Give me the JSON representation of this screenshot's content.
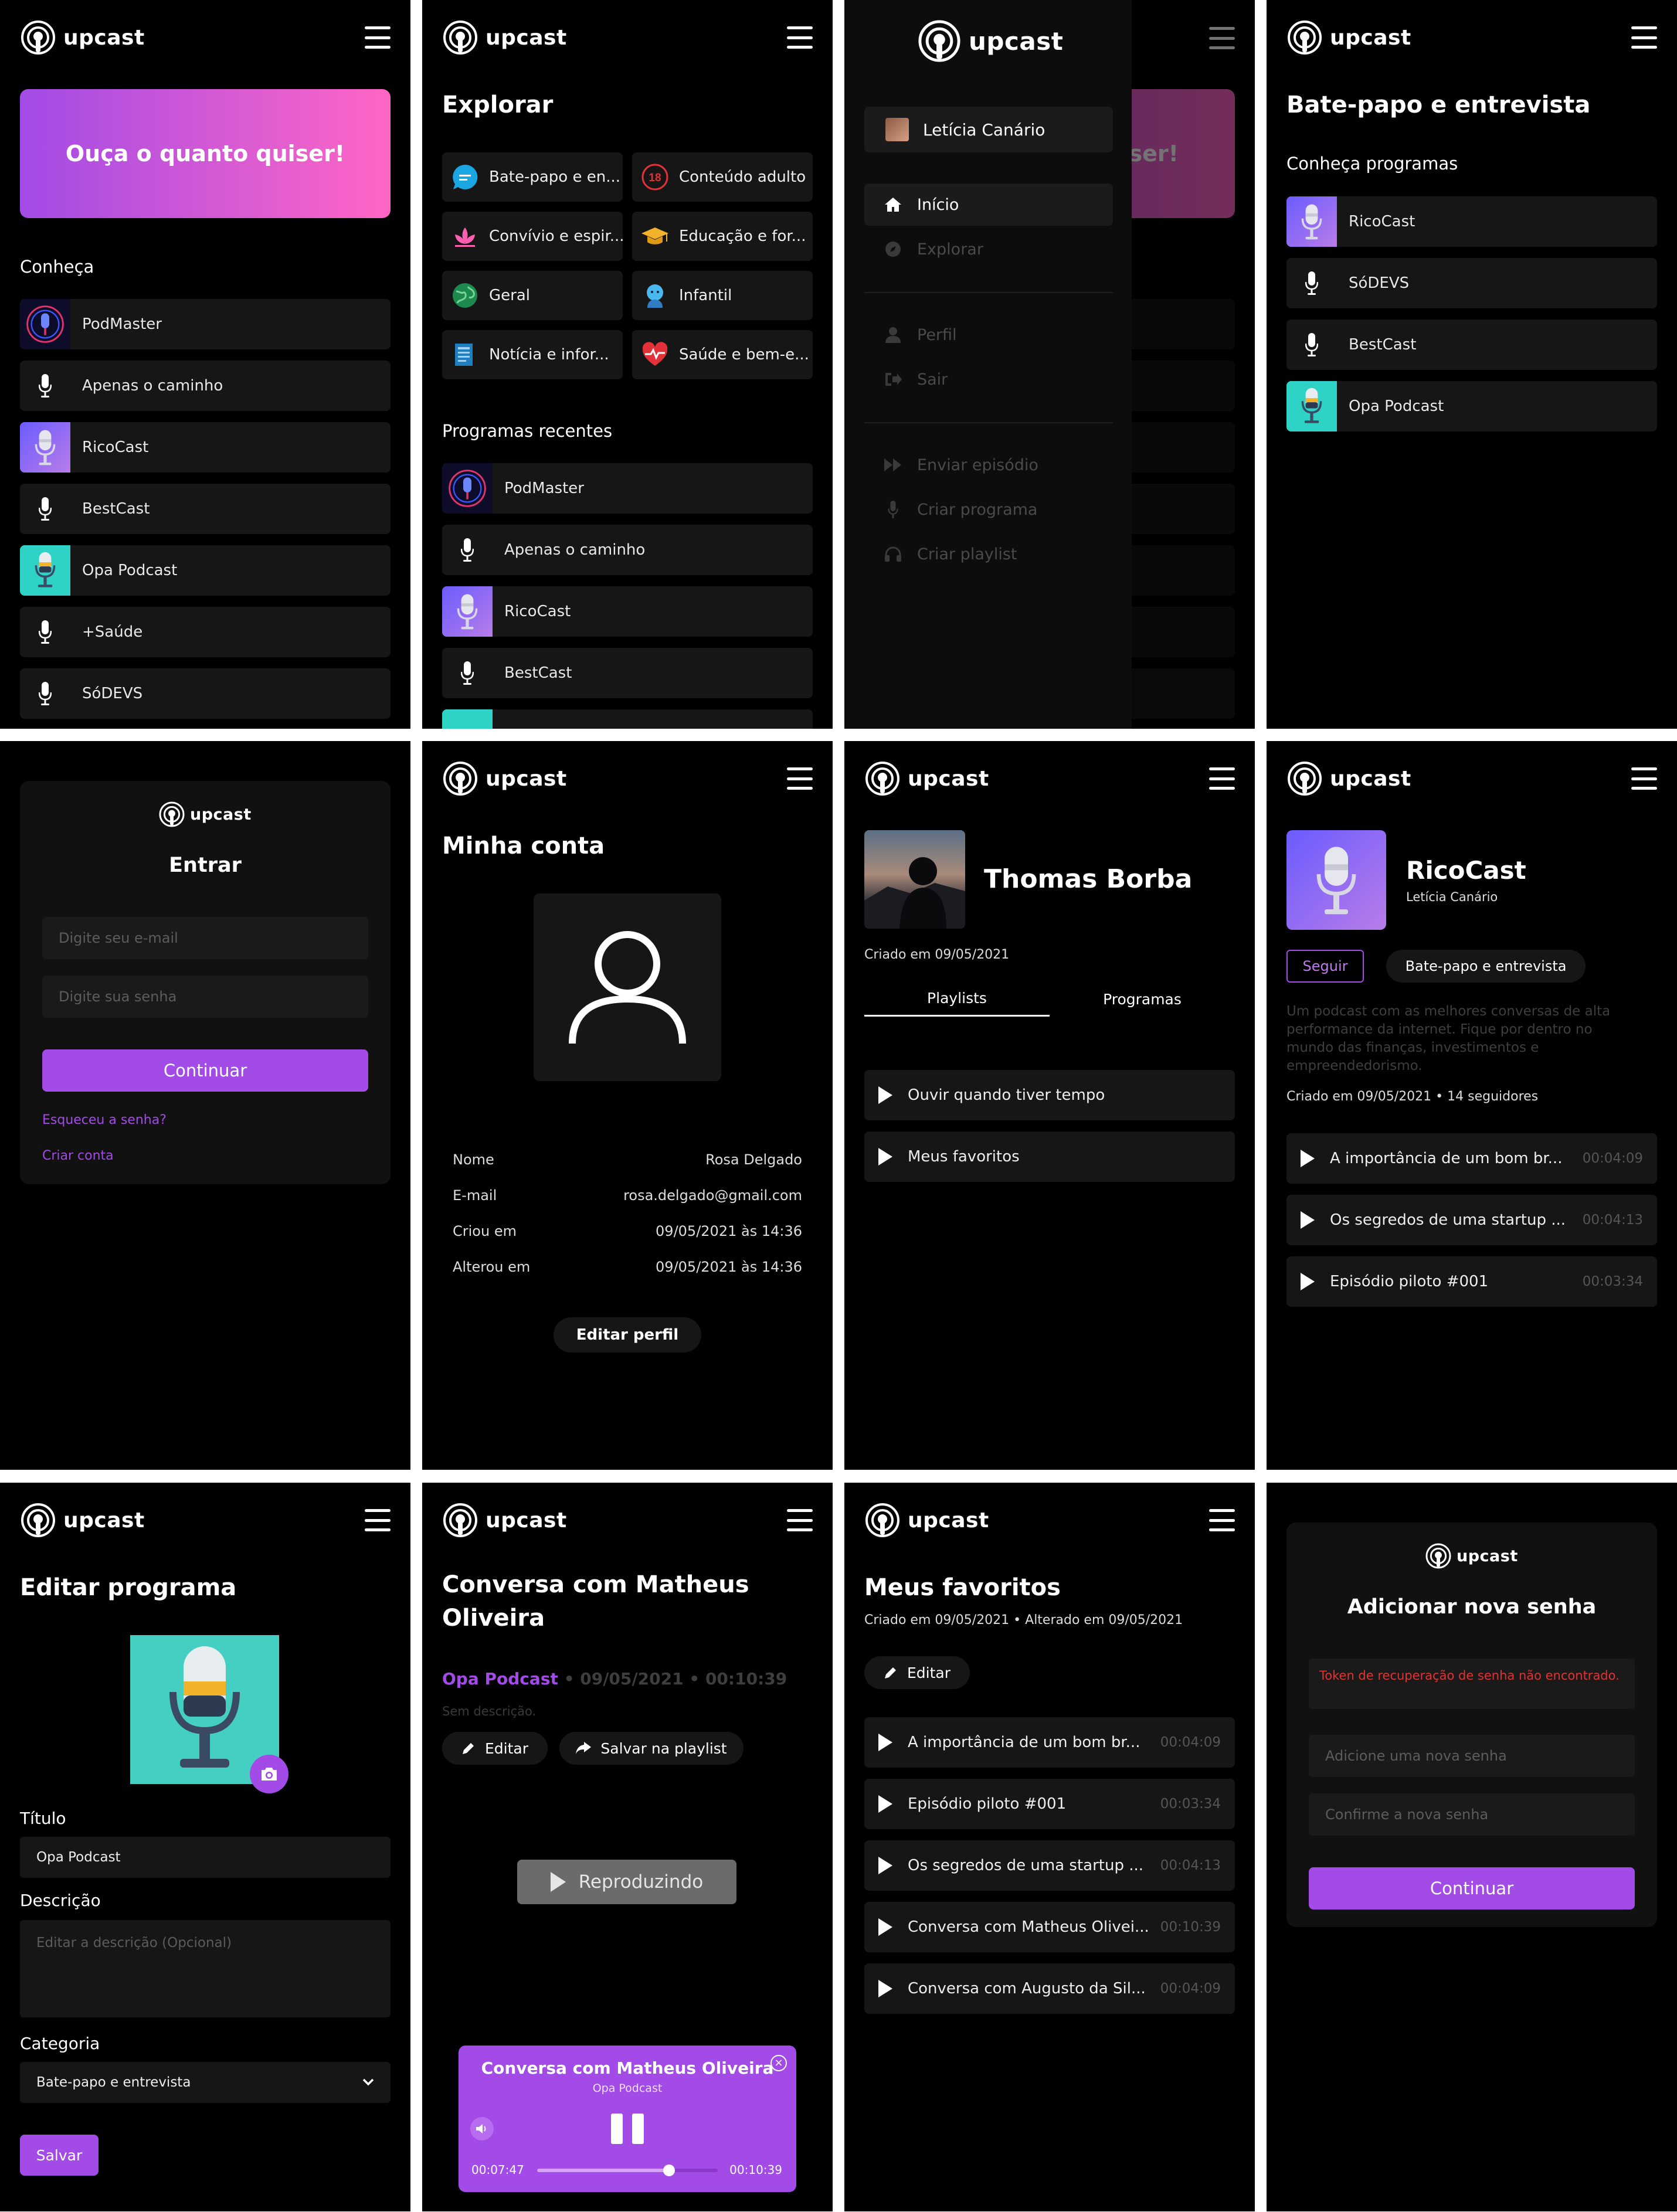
{
  "brand": {
    "name": "upcast",
    "accent": "#a24be6"
  },
  "home": {
    "banner": "Ouça o quanto quiser!",
    "section": "Conheça",
    "items": [
      {
        "label": "PodMaster",
        "thumb": "podmaster"
      },
      {
        "label": "Apenas o caminho",
        "thumb": "mic"
      },
      {
        "label": "RicoCast",
        "thumb": "ricocast"
      },
      {
        "label": "BestCast",
        "thumb": "mic"
      },
      {
        "label": "Opa Podcast",
        "thumb": "opa"
      },
      {
        "label": "+Saúde",
        "thumb": "mic"
      },
      {
        "label": "SóDEVS",
        "thumb": "mic"
      }
    ]
  },
  "explore": {
    "title": "Explorar",
    "categories": [
      "Bate-papo e en...",
      "Conteúdo adulto",
      "Convívio e espir...",
      "Educação e for...",
      "Geral",
      "Infantil",
      "Notícia e infor...",
      "Saúde e bem-e..."
    ],
    "recent_title": "Programas recentes",
    "recent": [
      "PodMaster",
      "Apenas o caminho",
      "RicoCast",
      "BestCast"
    ]
  },
  "drawer": {
    "user": "Letícia Canário",
    "banner_peek": "iser!",
    "items": [
      "Início",
      "Explorar",
      "Perfil",
      "Sair",
      "Enviar episódio",
      "Criar programa",
      "Criar playlist"
    ]
  },
  "category_page": {
    "title": "Bate-papo e entrevista",
    "subtitle": "Conheça programas",
    "items": [
      "RicoCast",
      "SóDEVS",
      "BestCast",
      "Opa Podcast"
    ]
  },
  "login": {
    "brand": "upcast",
    "title": "Entrar",
    "email_placeholder": "Digite seu e-mail",
    "password_placeholder": "Digite sua senha",
    "submit": "Continuar",
    "forgot": "Esqueceu a senha?",
    "create": "Criar conta"
  },
  "account": {
    "title": "Minha conta",
    "rows": [
      {
        "k": "Nome",
        "v": "Rosa Delgado"
      },
      {
        "k": "E-mail",
        "v": "rosa.delgado@gmail.com"
      },
      {
        "k": "Criou em",
        "v": "09/05/2021 às 14:36"
      },
      {
        "k": "Alterou em",
        "v": "09/05/2021 às 14:36"
      }
    ],
    "edit": "Editar perfil"
  },
  "profile": {
    "name": "Thomas Borba",
    "created": "Criado em 09/05/2021",
    "tabs": [
      "Playlists",
      "Programas"
    ],
    "playlists": [
      "Ouvir quando tiver tempo",
      "Meus favoritos"
    ]
  },
  "program": {
    "name": "RicoCast",
    "author": "Letícia Canário",
    "follow": "Seguir",
    "category": "Bate-papo e entrevista",
    "description": "Um podcast com as melhores conversas de alta performance da internet. Fique por dentro no mundo das finanças, investimentos e empreendedorismo.",
    "meta": "Criado em 09/05/2021 • 14 seguidores",
    "episodes": [
      {
        "t": "A importância de um bom br...",
        "d": "00:04:09"
      },
      {
        "t": "Os segredos de uma startup ...",
        "d": "00:04:13"
      },
      {
        "t": "Episódio piloto #001",
        "d": "00:03:34"
      }
    ]
  },
  "edit_program": {
    "title": "Editar programa",
    "title_label": "Título",
    "title_value": "Opa Podcast",
    "desc_label": "Descrição",
    "desc_placeholder": "Editar a descrição (Opcional)",
    "cat_label": "Categoria",
    "cat_value": "Bate-papo e entrevista",
    "save": "Salvar"
  },
  "episode": {
    "title": "Conversa com Matheus Oliveira",
    "program": "Opa Podcast",
    "meta": " • 09/05/2021 • 00:10:39",
    "description": "Sem descrição.",
    "edit": "Editar",
    "save_playlist": "Salvar na playlist",
    "playing": "Reproduzindo",
    "player": {
      "title": "Conversa com Matheus Oliveira",
      "program": "Opa Podcast",
      "current": "00:07:47",
      "total": "00:10:39",
      "progress": 0.73
    }
  },
  "favorites": {
    "title": "Meus favoritos",
    "meta": "Criado em 09/05/2021 • Alterado em 09/05/2021",
    "edit": "Editar",
    "episodes": [
      {
        "t": "A importância de um bom br...",
        "d": "00:04:09"
      },
      {
        "t": "Episódio piloto #001",
        "d": "00:03:34"
      },
      {
        "t": "Os segredos de uma startup ...",
        "d": "00:04:13"
      },
      {
        "t": "Conversa com Matheus Olivei...",
        "d": "00:10:39"
      },
      {
        "t": "Conversa com Augusto da Sil...",
        "d": "00:04:09"
      }
    ]
  },
  "reset": {
    "brand": "upcast",
    "title": "Adicionar nova senha",
    "error": "Token de recuperação de senha não encontrado.",
    "new_placeholder": "Adicione uma nova senha",
    "confirm_placeholder": "Confirme a nova senha",
    "submit": "Continuar"
  }
}
